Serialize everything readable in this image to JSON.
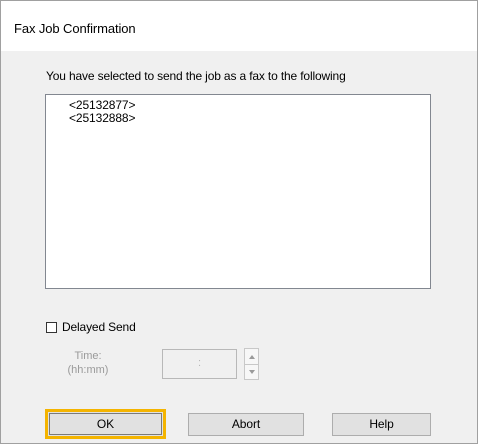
{
  "dialog": {
    "title": "Fax Job Confirmation",
    "description": "You have selected to send the job as a fax to the following",
    "recipients": [
      "<25132877>",
      "<25132888>"
    ],
    "delayed_send_label": "Delayed Send",
    "delayed_send_checked": false,
    "time_label_line1": "Time:",
    "time_label_line2": "(hh:mm)",
    "time_value": ":",
    "buttons": {
      "ok": "OK",
      "abort": "Abort",
      "help": "Help"
    },
    "focus_highlight_color": "#f4b400"
  }
}
